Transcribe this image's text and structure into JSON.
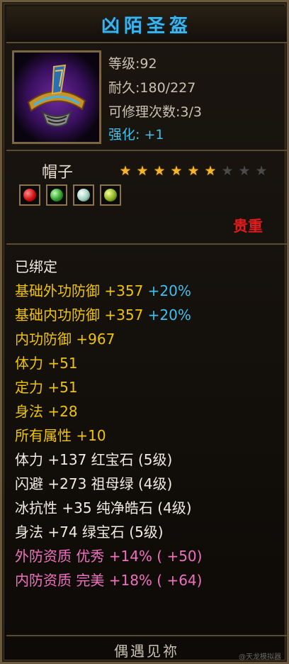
{
  "item": {
    "name": "凶陌圣盔",
    "level": "等级:92",
    "durability": "耐久:180/227",
    "repairs": "可修理次数:3/3",
    "enhance_label": "强化:",
    "enhance_value": "+1",
    "type": "帽子",
    "stars_total": 9,
    "stars_lit": 6,
    "rarity": "贵重",
    "gems": [
      "red-gem",
      "green-gem",
      "white-gem",
      "yellow-green-gem"
    ],
    "footer": "偶遇见祢",
    "watermark": "@天龙模拟器"
  },
  "stats": [
    {
      "id": "bound",
      "color": "white",
      "parts": [
        "已绑定"
      ]
    },
    {
      "id": "base-outer-def",
      "color": "gold",
      "parts": [
        "基础外功防御 +357 "
      ],
      "extra": "+20%"
    },
    {
      "id": "base-inner-def",
      "color": "gold",
      "parts": [
        "基础内功防御 +357 "
      ],
      "extra": "+20%"
    },
    {
      "id": "inner-def",
      "color": "gold",
      "parts": [
        "内功防御 +967"
      ]
    },
    {
      "id": "stamina",
      "color": "gold",
      "parts": [
        "体力 +51"
      ]
    },
    {
      "id": "focus",
      "color": "gold",
      "parts": [
        "定力 +51"
      ]
    },
    {
      "id": "agility",
      "color": "gold",
      "parts": [
        "身法 +28"
      ]
    },
    {
      "id": "all-attrs",
      "color": "gold",
      "parts": [
        "所有属性 +10"
      ]
    },
    {
      "id": "gem-stamina",
      "color": "white",
      "parts": [
        "体力 +137 红宝石 (5级)"
      ]
    },
    {
      "id": "gem-dodge",
      "color": "white",
      "parts": [
        "闪避 +273 祖母绿 (4级)"
      ]
    },
    {
      "id": "gem-ice",
      "color": "white",
      "parts": [
        "冰抗性 +35 纯净皓石 (4级)"
      ]
    },
    {
      "id": "gem-agility",
      "color": "white",
      "parts": [
        "身法 +74 绿宝石 (5级)"
      ]
    },
    {
      "id": "outer-quality",
      "color": "pink",
      "parts": [
        "外防资质   优秀  +14% ( +50)"
      ]
    },
    {
      "id": "inner-quality",
      "color": "pink",
      "parts": [
        "内防资质   完美  +18% ( +64)"
      ]
    }
  ],
  "colors": {
    "title": "#3fb4e8",
    "gold": "#f0c400",
    "pink": "#f070c0",
    "cyan": "#3fc0ee",
    "rarity": "#e21c1c"
  }
}
